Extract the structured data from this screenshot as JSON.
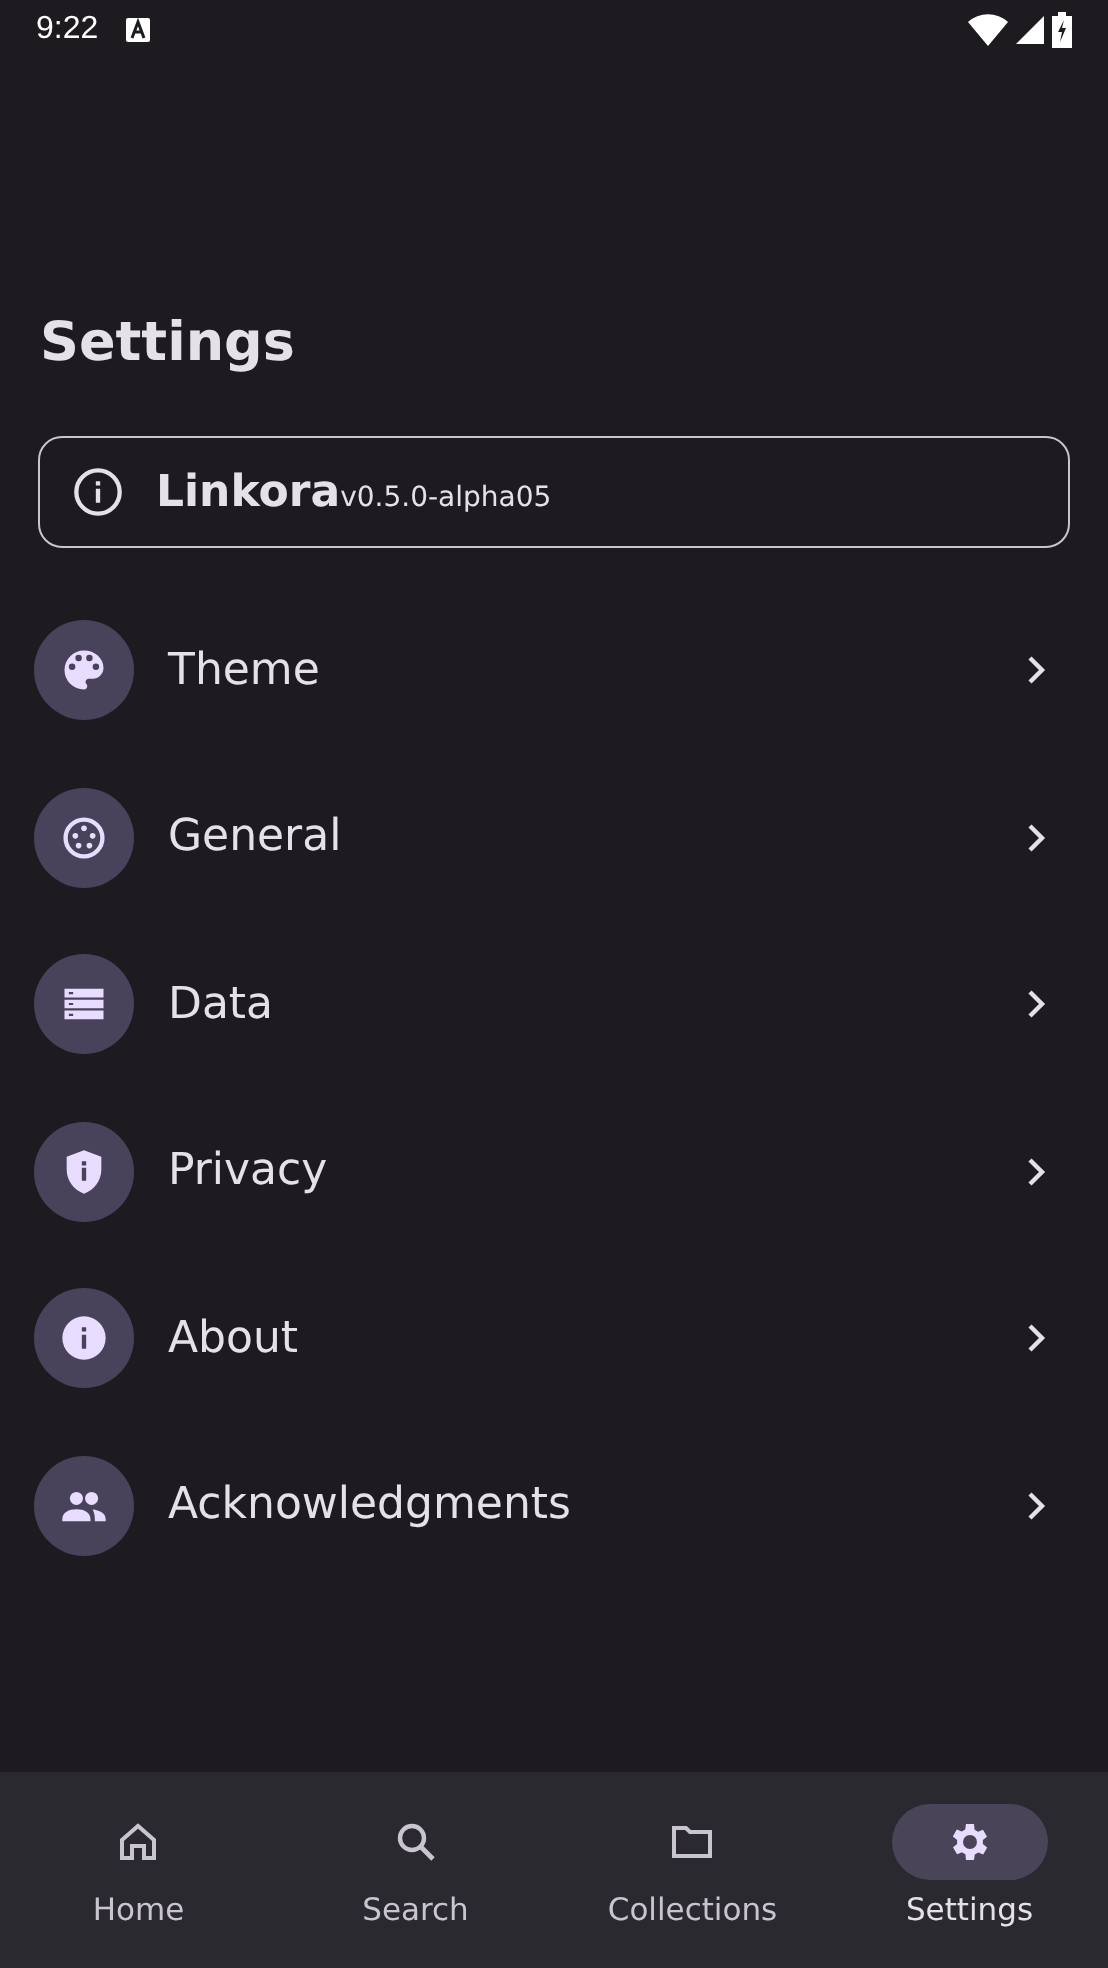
{
  "status_bar": {
    "time": "9:22"
  },
  "title": "Settings",
  "app_info": {
    "name": "Linkora",
    "version": "v0.5.0-alpha05"
  },
  "items": [
    {
      "label": "Theme"
    },
    {
      "label": "General"
    },
    {
      "label": "Data"
    },
    {
      "label": "Privacy"
    },
    {
      "label": "About"
    },
    {
      "label": "Acknowledgments"
    }
  ],
  "nav": [
    {
      "label": "Home",
      "selected": false
    },
    {
      "label": "Search",
      "selected": false
    },
    {
      "label": "Collections",
      "selected": false
    },
    {
      "label": "Settings",
      "selected": true
    }
  ]
}
